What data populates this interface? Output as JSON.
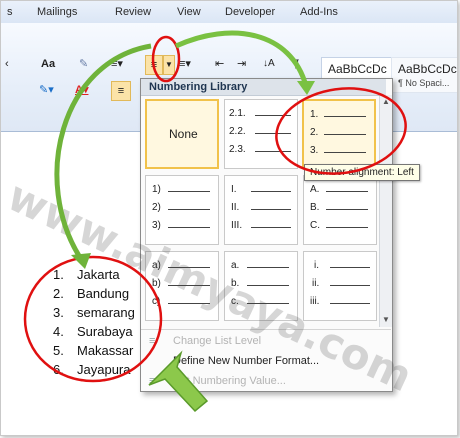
{
  "ribbon": {
    "tabs": [
      "s",
      "Mailings",
      "Review",
      "View",
      "Developer",
      "Add-Ins"
    ],
    "styles": [
      {
        "preview": "AaBbCcDc",
        "name": ""
      },
      {
        "preview": "AaBbCcDc",
        "name": "¶ No Spaci..."
      }
    ],
    "font_size_btn": "Aa",
    "pilcrow": "¶"
  },
  "dropdown": {
    "header": "Numbering Library",
    "none_label": "None",
    "cells": [
      [
        "1.",
        "2.",
        "3."
      ],
      [
        "1)",
        "2)",
        "3)"
      ],
      [
        "I.",
        "II.",
        "III."
      ],
      [
        "A.",
        "B.",
        "C."
      ],
      [
        "a)",
        "b)",
        "c)"
      ],
      [
        "a.",
        "b.",
        "c."
      ],
      [
        "i.",
        "ii.",
        "iii."
      ]
    ],
    "cell_multi": [
      "2.1.",
      "2.2.",
      "2.3."
    ],
    "menu": [
      "Change List Level",
      "Define New Number Format...",
      "Set Numbering Value..."
    ]
  },
  "tooltip": "Number alignment: Left",
  "document": {
    "list": [
      {
        "num": "1.",
        "text": "Jakarta"
      },
      {
        "num": "2.",
        "text": "Bandung"
      },
      {
        "num": "3.",
        "text": "semarang"
      },
      {
        "num": "4.",
        "text": "Surabaya"
      },
      {
        "num": "5.",
        "text": "Makassar"
      },
      {
        "num": "6.",
        "text": "Jayapura"
      }
    ]
  },
  "watermark": "www.aimyaya.com",
  "colors": {
    "annotation_red": "#e01010",
    "arrow_green": "#7ac142",
    "selection": "#f1c24b"
  }
}
